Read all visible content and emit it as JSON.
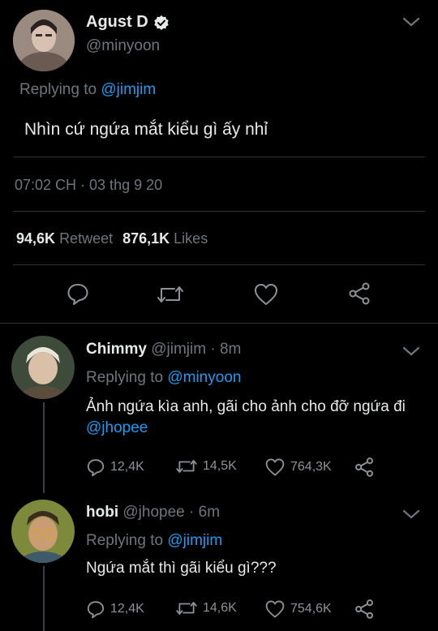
{
  "main_tweet": {
    "name": "Agust D",
    "handle": "@minyoon",
    "replying_prefix": "Replying to",
    "replying_to": "@jimjim",
    "text": "Nhìn cứ ngứa mắt kiểu gì ấy nhỉ",
    "timestamp": "07:02 CH · 03 thg 9 20",
    "retweets_count": "94,6K",
    "retweets_label": "Retweet",
    "likes_count": "876,1K",
    "likes_label": "Likes"
  },
  "replies": [
    {
      "name": "Chimmy",
      "handle": "@jimjim",
      "time": "· 8m",
      "replying_prefix": "Replying to",
      "replying_to": "@minyoon",
      "text_before_mention": "Ảnh ngứa kìa anh, gãi cho ảnh cho đỡ ngứa đi ",
      "mention": "@jhopee",
      "replies": "12,4K",
      "retweets": "14,5K",
      "likes": "764,3K"
    },
    {
      "name": "hobi",
      "handle": "@jhopee",
      "time": "· 6m",
      "replying_prefix": "Replying to",
      "replying_to": "@jimjim",
      "text": "Ngứa mắt thì gãi kiểu gì???",
      "replies": "12,4K",
      "retweets": "14,6K",
      "likes": "754,6K"
    }
  ],
  "colors": {
    "background": "#000000",
    "accent": "#1d9bf0",
    "muted": "#6e767d",
    "divider": "#2f3336"
  }
}
